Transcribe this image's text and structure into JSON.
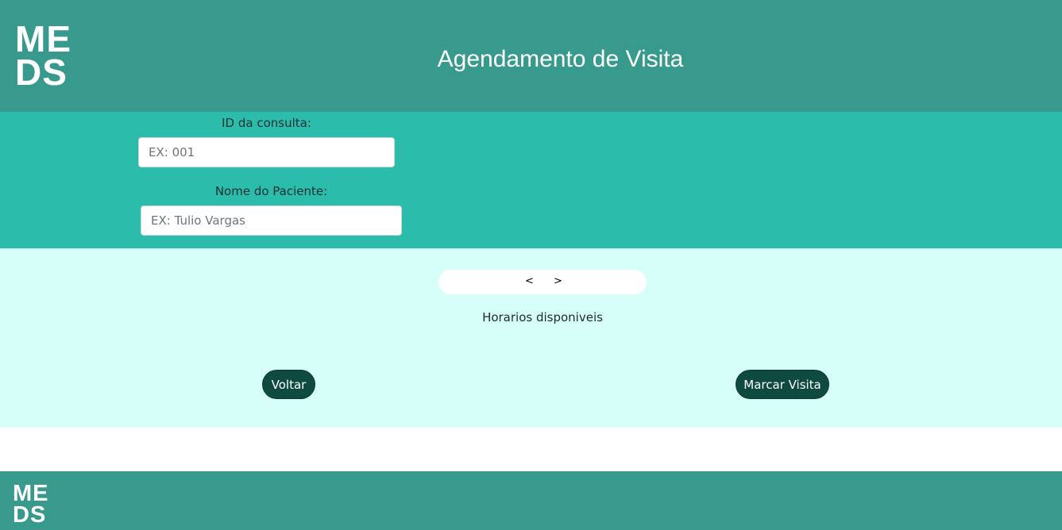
{
  "header": {
    "logo_line1": "ME",
    "logo_line2": "DS",
    "title": "Agendamento de Visita"
  },
  "form": {
    "consulta_id": {
      "label": "ID da consulta:",
      "placeholder": "EX: 001",
      "value": ""
    },
    "paciente_nome": {
      "label": "Nome do Paciente:",
      "placeholder": "EX: Tulio Vargas",
      "value": ""
    }
  },
  "schedule": {
    "prev_label": "<",
    "next_label": ">",
    "available_label": "Horarios disponiveis"
  },
  "actions": {
    "back_label": "Voltar",
    "submit_label": "Marcar Visita"
  },
  "footer": {
    "logo_line1": "ME",
    "logo_line2": "DS"
  },
  "colors": {
    "header_bg": "#389a8c",
    "form_bg": "#2bbcac",
    "schedule_bg": "#d6fffa",
    "button_bg": "#0f4a41"
  }
}
